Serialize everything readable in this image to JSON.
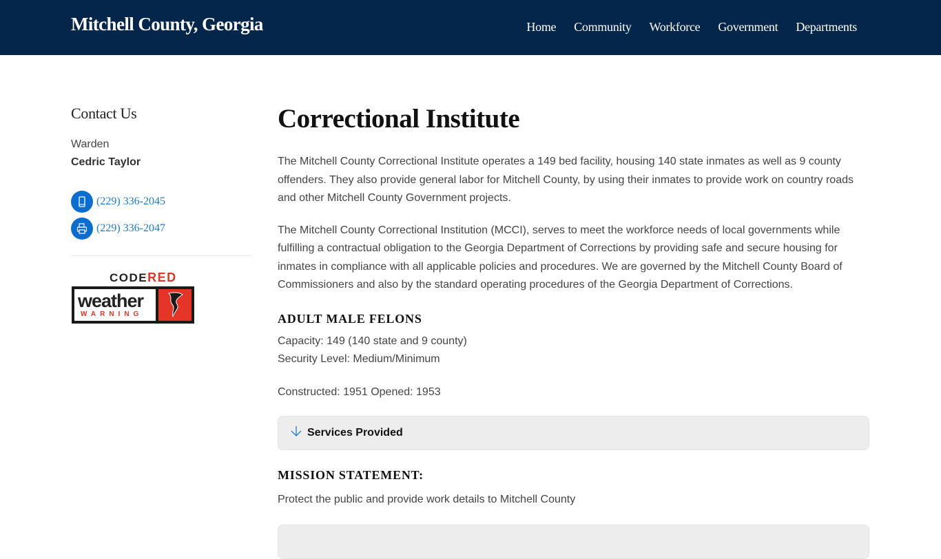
{
  "header": {
    "site_title": "Mitchell County, Georgia",
    "nav": [
      {
        "label": "Home"
      },
      {
        "label": "Community"
      },
      {
        "label": "Workforce"
      },
      {
        "label": "Government"
      },
      {
        "label": "Departments"
      }
    ],
    "background_color": "#05264b"
  },
  "sidebar": {
    "title": "Contact Us",
    "role": "Warden",
    "name": "Cedric Taylor",
    "phones": [
      {
        "icon": "mobile-phone-icon",
        "number": "(229) 336-2045"
      },
      {
        "icon": "fax-printer-icon",
        "number": "(229) 336-2047"
      }
    ],
    "banner": {
      "code": "CODE",
      "red": "RED",
      "word": "weather",
      "warning": "WARNING"
    },
    "accent_color": "#0a6ed1"
  },
  "main": {
    "title": "Correctional Institute",
    "paragraphs": [
      "The Mitchell County Correctional Institute operates a 149 bed facility, housing 140 state inmates as well as 9 county offenders. They also provide general labor for Mitchell County, by using their inmates to provide work on country roads and other Mitchell County Government projects.",
      "The Mitchell County Correctional Institution (MCCI), serves to meet the workforce needs of local governments while fulfilling a contractual obligation to the  Georgia  Department of Corrections by providing safe and secure housing for inmates in compliance with all applicable policies and procedures. We are governed by the Mitchell County Board of Commissioners and also by the standard operating procedures of the Georgia Department of Corrections."
    ],
    "felons_heading": "ADULT MALE FELONS",
    "facts": {
      "capacity": "Capacity: 149 (140 state and 9 county)",
      "security": "Security Level: Medium/Minimum",
      "dates": "Constructed: 1951 Opened: 1953"
    },
    "accordion": {
      "icon": "arrow-down-icon",
      "label": "Services Provided"
    },
    "mission_heading": "MISSION STATEMENT:",
    "mission_text": "Protect the public and provide work details to Mitchell County"
  }
}
